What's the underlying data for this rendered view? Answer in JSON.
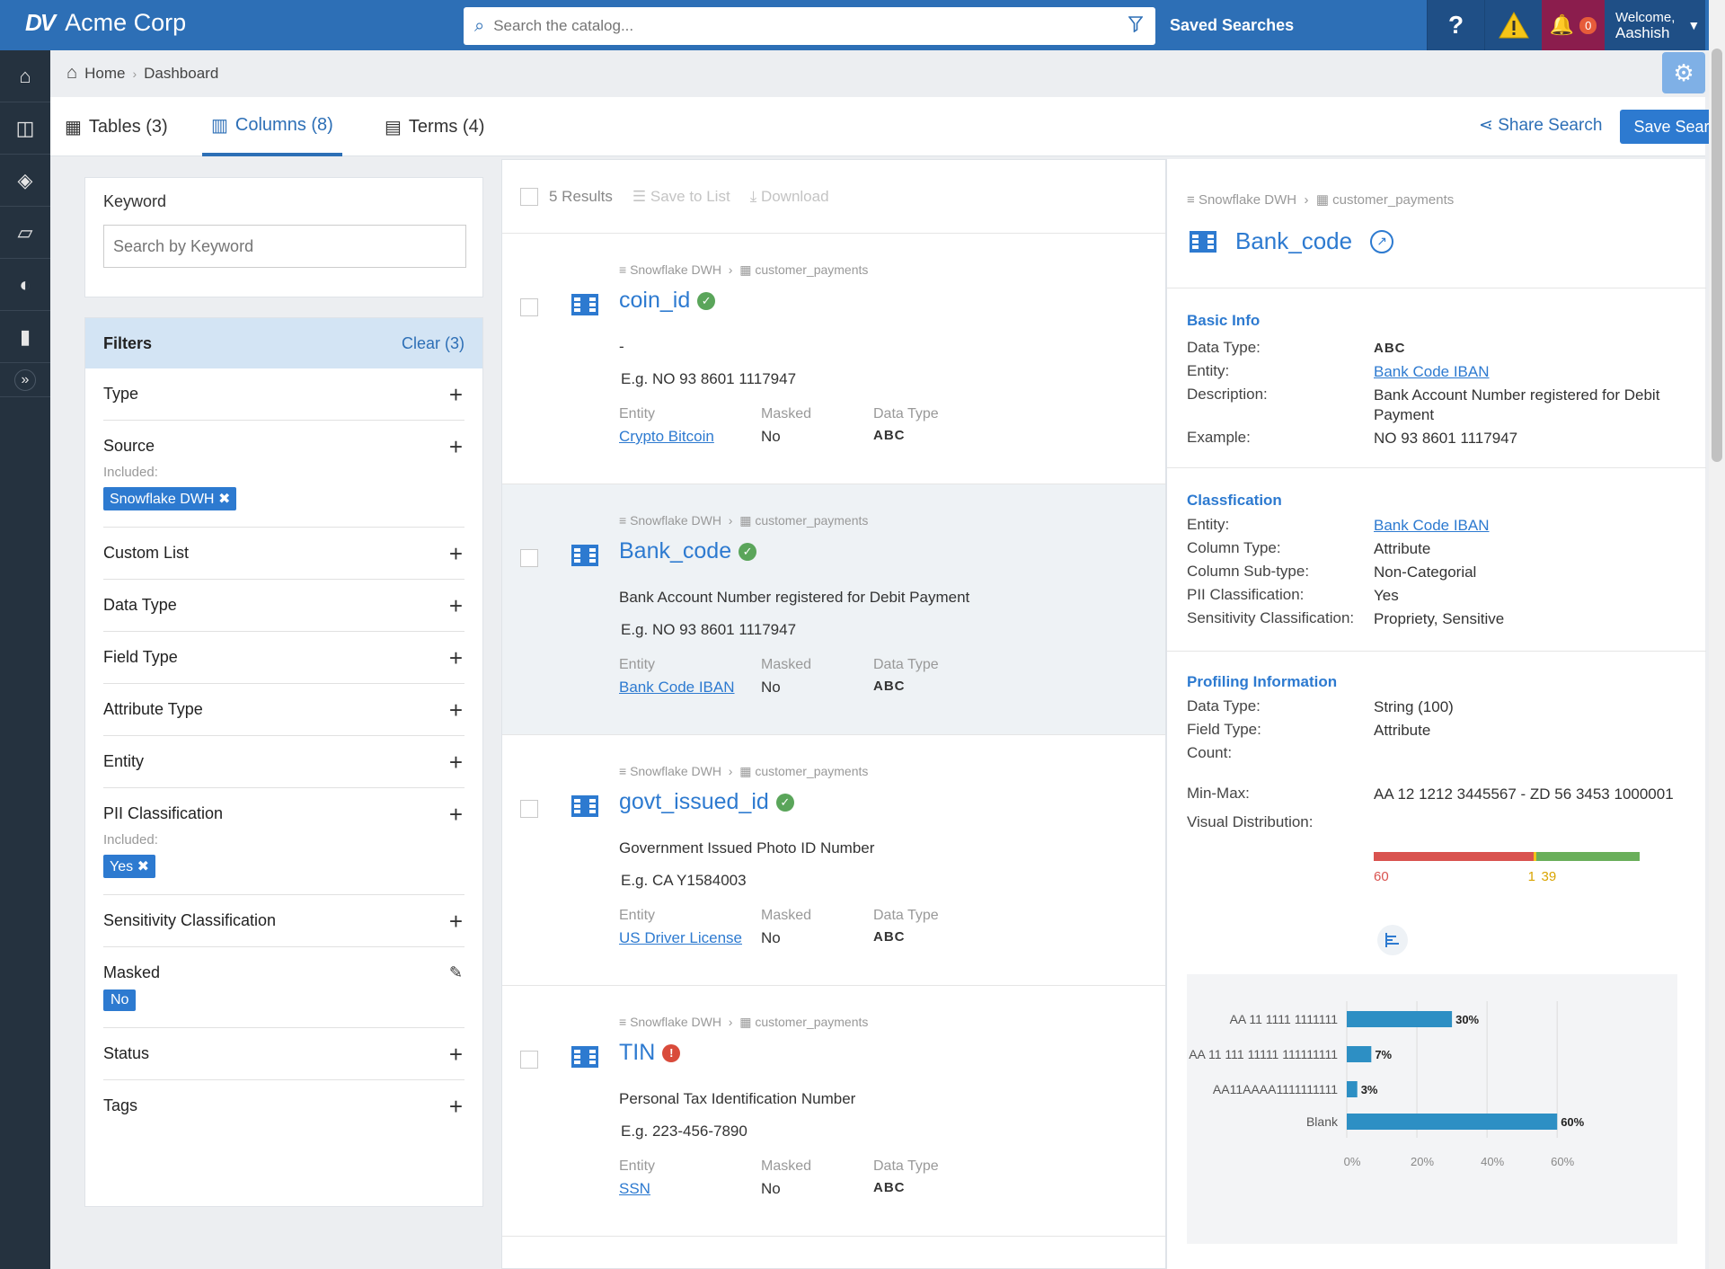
{
  "app": {
    "logo_mark": "DV",
    "brand": "Acme Corp"
  },
  "topbar": {
    "search_placeholder": "Search the catalog...",
    "saved_searches": "Saved Searches",
    "help": "?",
    "notifications": "0",
    "welcome_line1": "Welcome,",
    "welcome_line2": "Aashish"
  },
  "breadcrumb": [
    "Home",
    "Dashboard"
  ],
  "tabs": [
    {
      "label": "Tables (3)"
    },
    {
      "label": "Columns (8)",
      "active": true
    },
    {
      "label": "Terms (4)"
    }
  ],
  "actions": {
    "share": "Share Search",
    "save": "Save Search"
  },
  "keyword": {
    "label": "Keyword",
    "placeholder": "Search by Keyword"
  },
  "filters": {
    "title": "Filters",
    "clear": "Clear (3)",
    "included_label": "Included:",
    "items": [
      {
        "label": "Type"
      },
      {
        "label": "Source",
        "chip": "Snowflake DWH"
      },
      {
        "label": "Custom List"
      },
      {
        "label": "Data Type"
      },
      {
        "label": "Field Type"
      },
      {
        "label": "Attribute Type"
      },
      {
        "label": "Entity"
      },
      {
        "label": "PII Classification",
        "chip": "Yes"
      },
      {
        "label": "Sensitivity Classification"
      },
      {
        "label": "Masked",
        "value": "No"
      },
      {
        "label": "Status"
      },
      {
        "label": "Tags"
      }
    ]
  },
  "results": {
    "count": "5 Results",
    "save_to_list": "Save to List",
    "download": "Download",
    "items": [
      {
        "source": "Snowflake DWH",
        "table": "customer_payments",
        "name": "coin_id",
        "status": "ok",
        "desc": "-",
        "example": "E.g. NO 93 8601 1117947",
        "entity": "Crypto Bitcoin",
        "masked": "No",
        "data_type": "ABC"
      },
      {
        "source": "Snowflake DWH",
        "table": "customer_payments",
        "name": "Bank_code",
        "status": "ok",
        "desc": "Bank Account Number registered for Debit Payment",
        "example": "E.g. NO 93 8601 1117947",
        "entity": "Bank Code IBAN",
        "masked": "No",
        "data_type": "ABC"
      },
      {
        "source": "Snowflake DWH",
        "table": "customer_payments",
        "name": "govt_issued_id",
        "status": "ok",
        "desc": "Government Issued Photo ID Number",
        "example": "E.g. CA Y1584003",
        "entity": "US Driver License",
        "masked": "No",
        "data_type": "ABC"
      },
      {
        "source": "Snowflake DWH",
        "table": "customer_payments",
        "name": "TIN",
        "status": "err",
        "desc": "Personal Tax Identification Number",
        "example": "E.g. 223-456-7890",
        "entity": "SSN",
        "masked": "No",
        "data_type": "ABC"
      }
    ],
    "meta_labels": {
      "entity": "Entity",
      "masked": "Masked",
      "data_type": "Data Type"
    }
  },
  "detail": {
    "source": "Snowflake DWH",
    "table": "customer_payments",
    "title": "Bank_code",
    "basic": {
      "heading": "Basic Info",
      "rows": [
        {
          "k": "Data Type:",
          "v": "ABC"
        },
        {
          "k": "Entity:",
          "v": "Bank Code IBAN"
        },
        {
          "k": "Description:",
          "v": "Bank Account Number registered for Debit Payment"
        },
        {
          "k": "Example:",
          "v": "NO 93 8601 1117947"
        }
      ]
    },
    "classification": {
      "heading": "Classfication",
      "rows": [
        {
          "k": "Entity:",
          "v": "Bank Code IBAN"
        },
        {
          "k": "Column Type:",
          "v": "Attribute"
        },
        {
          "k": "Column Sub-type:",
          "v": "Non-Categorial"
        },
        {
          "k": "PII Classification:",
          "v": "Yes"
        },
        {
          "k": "Sensitivity Classification:",
          "v": "Propriety, Sensitive"
        }
      ]
    },
    "profiling": {
      "heading": "Profiling Information",
      "rows": [
        {
          "k": "Data Type:",
          "v": "String (100)"
        },
        {
          "k": "Field Type:",
          "v": "Attribute"
        },
        {
          "k": "Count:",
          "v": ""
        },
        {
          "k": "Min-Max:",
          "v": "AA 12 1212 3445567 - ZD 56 3453 1000001"
        },
        {
          "k": "Visual Distribution:",
          "v": ""
        }
      ],
      "count": {
        "red": 60,
        "yellow": 1,
        "green": 39,
        "red_label": "60",
        "yellow_label": "1",
        "green_label": "39",
        "colors": {
          "red": "#d9534f",
          "yellow": "#f0c419",
          "green": "#6aaf5a"
        }
      }
    }
  },
  "chart_data": {
    "type": "bar",
    "orientation": "horizontal",
    "categories": [
      "AA 11 1111 1111111",
      "AA 11 111 11111 111111111",
      "AA11AAAA1111111111",
      "Blank"
    ],
    "values": [
      30,
      7,
      3,
      60
    ],
    "value_labels": [
      "30%",
      "7%",
      "3%",
      "60%"
    ],
    "xticks": [
      "0%",
      "20%",
      "40%",
      "60%"
    ],
    "xlim": [
      0,
      62
    ],
    "color": "#2d8fc4"
  }
}
